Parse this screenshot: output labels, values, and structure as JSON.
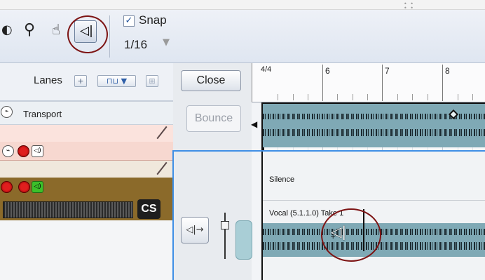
{
  "toolbar": {
    "tools": [
      {
        "icon": "zoom-icon",
        "glyph": "⚲"
      },
      {
        "icon": "hand-icon",
        "glyph": "☝"
      },
      {
        "icon": "speaker-icon",
        "glyph": "🔈"
      }
    ],
    "snap": {
      "checked": true,
      "label": "Snap",
      "value": "1/16"
    }
  },
  "tracks_panel": {
    "lanes_label": "Lanes",
    "transport_label": "Transport",
    "cs_label": "CS"
  },
  "clip_controls": {
    "close_label": "Close",
    "bounce_label": "Bounce",
    "monitor_glyph": "◁|→"
  },
  "timeline": {
    "time_signature": "4/4",
    "bars": [
      "6",
      "7",
      "8"
    ],
    "silence_label": "Silence",
    "take_label": "Vocal (5.1.1.0) Take 1"
  },
  "colors": {
    "accent_blue": "#3f8fe6",
    "clip_teal": "#7fa9b5",
    "highlight_circle": "#7d1414",
    "track_brown": "#8b6a2a",
    "track_pink": "#fbe3dd"
  }
}
